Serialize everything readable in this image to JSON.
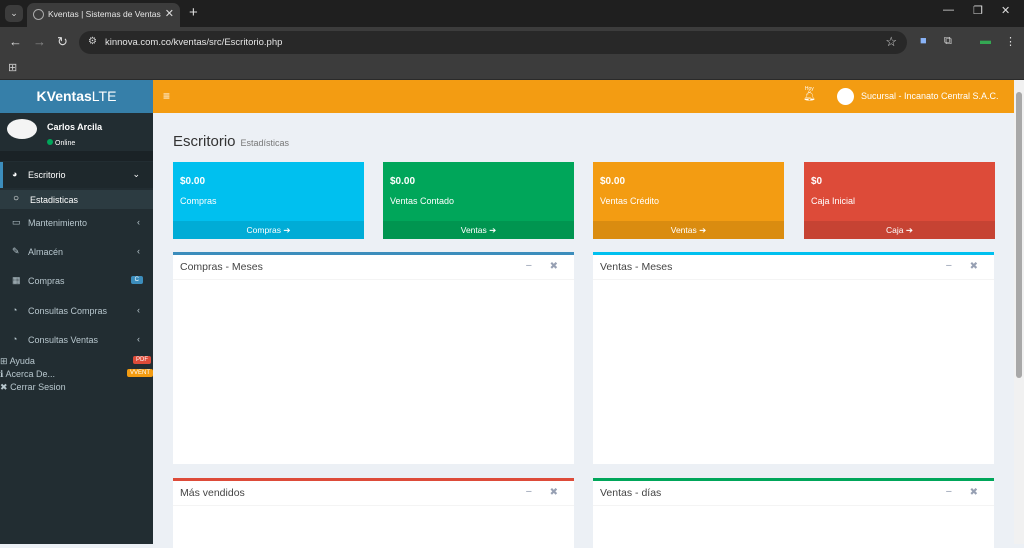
{
  "browser": {
    "tab_title": "Kventas | Sistemas de Ventas",
    "url": "kinnova.com.co/kventas/src/Escritorio.php"
  },
  "app": {
    "logo_bold": "KVentas",
    "logo_light": "LTE",
    "hoy_label": "Hoy",
    "branch": "Sucursal - Incanato Central S.A.C."
  },
  "user": {
    "name": "Carlos Arcila",
    "status": "Online"
  },
  "sidebar": {
    "items": [
      {
        "label": "Escritorio"
      },
      {
        "label": "Estadisticas"
      },
      {
        "label": "Mantenimiento"
      },
      {
        "label": "Almacén"
      },
      {
        "label": "Compras",
        "badge": "C"
      },
      {
        "label": "Consultas Compras"
      },
      {
        "label": "Consultas Ventas"
      }
    ],
    "links": [
      {
        "label": "Ayuda",
        "tag": "PDF"
      },
      {
        "label": "Acerca De...",
        "tag": "VVENT"
      },
      {
        "label": "Cerrar Sesion"
      }
    ]
  },
  "content": {
    "title": "Escritorio",
    "subtitle": "Estadísticas",
    "boxes": [
      {
        "value": "$0.00",
        "label": "Compras",
        "footer": "Compras",
        "color": "#00c0ef"
      },
      {
        "value": "$0.00",
        "label": "Ventas Contado",
        "footer": "Ventas",
        "color": "#00a65a"
      },
      {
        "value": "$0.00",
        "label": "Ventas Crédito",
        "footer": "Ventas",
        "color": "#f39c12"
      },
      {
        "value": "$0",
        "label": "Caja Inicial",
        "footer": "Caja",
        "color": "#dd4b39"
      }
    ],
    "panels": [
      {
        "title": "Compras - Meses",
        "color": "#3c8dbc"
      },
      {
        "title": "Ventas - Meses",
        "color": "#00c0ef"
      },
      {
        "title": "Más vendidos",
        "color": "#dd4b39"
      },
      {
        "title": "Ventas - días",
        "color": "#00a65a"
      }
    ]
  }
}
